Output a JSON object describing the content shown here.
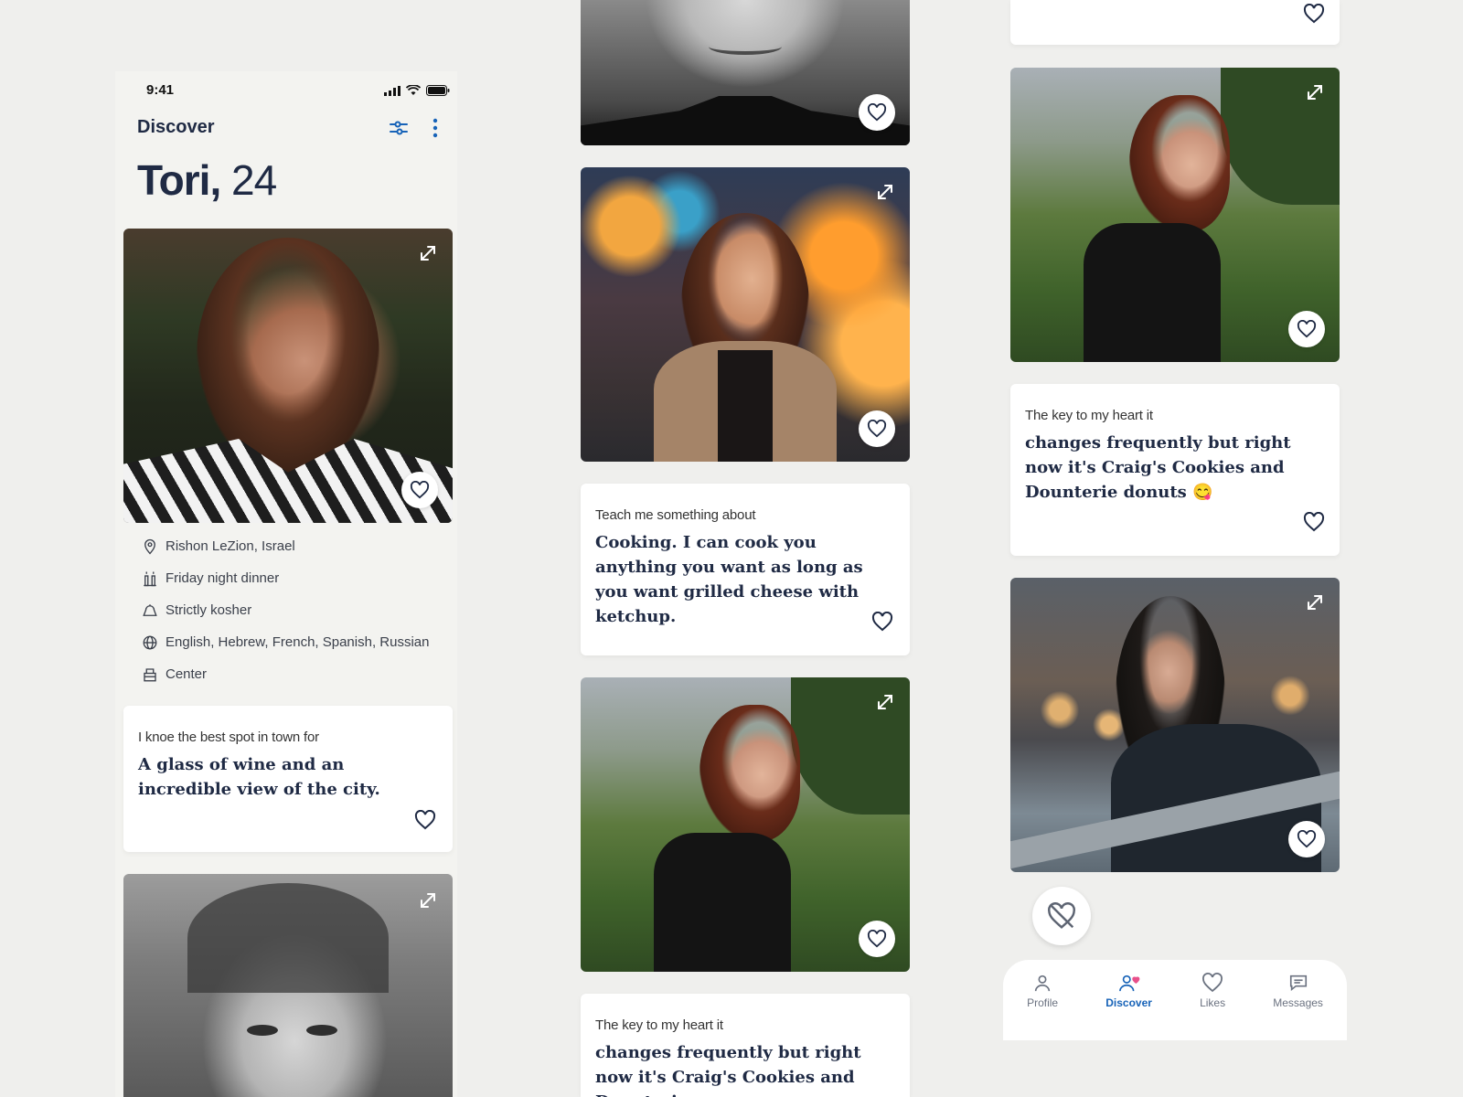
{
  "status": {
    "time": "9:41"
  },
  "header": {
    "title": "Discover",
    "filter_icon": "sliders-icon",
    "menu_icon": "more-vertical-icon"
  },
  "profile": {
    "name": "Tori,",
    "age": "24"
  },
  "info": [
    {
      "icon": "location-pin-icon",
      "text": "Rishon LeZion, Israel"
    },
    {
      "icon": "candles-icon",
      "text": "Friday night dinner"
    },
    {
      "icon": "kosher-icon",
      "text": "Strictly kosher"
    },
    {
      "icon": "globe-icon",
      "text": "English, Hebrew, French, Spanish, Russian"
    },
    {
      "icon": "synagogue-icon",
      "text": "Center"
    }
  ],
  "prompts": {
    "spot": {
      "question": "I knoe the best spot in town for",
      "answer": "A glass of wine and an incredible view of the city."
    },
    "teach": {
      "question": "Teach me something about",
      "answer": "Cooking. I can cook you anything you want as long as you want grilled cheese with ketchup."
    },
    "key_mid": {
      "question": "The key to my heart it",
      "answer": "changes frequently but right now it's Craig's Cookies and Dounterie"
    },
    "key_right": {
      "question": "The key to my heart it",
      "answer": "changes frequently but right now it's Craig's Cookies and Dounterie donuts 😋"
    }
  },
  "nav": {
    "items": [
      {
        "label": "Profile",
        "icon": "user-icon"
      },
      {
        "label": "Discover",
        "icon": "user-heart-icon"
      },
      {
        "label": "Likes",
        "icon": "heart-icon"
      },
      {
        "label": "Messages",
        "icon": "message-icon"
      }
    ],
    "active": "Discover"
  },
  "colors": {
    "accent": "#1763b8",
    "text": "#1f2a44",
    "background": "#efefed",
    "card": "#ffffff",
    "like": "#e8508a"
  }
}
